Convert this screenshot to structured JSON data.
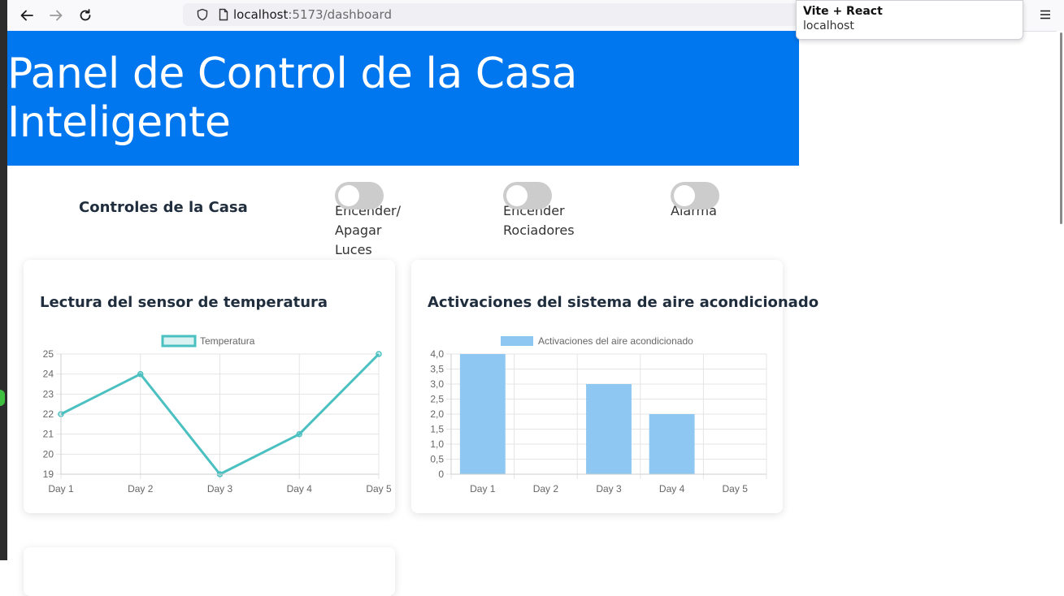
{
  "browser": {
    "url_host": "localhost",
    "url_rest": ":5173/dashboard",
    "tooltip_title": "Vite + React",
    "tooltip_sub": "localhost"
  },
  "header": {
    "title": "Panel de Control de la Casa Inteligente"
  },
  "controls": {
    "title": "Controles de la Casa",
    "toggles": [
      {
        "label": "Encender/ Apagar Luces",
        "on": false
      },
      {
        "label": "Encender Rociadores",
        "on": false
      },
      {
        "label": "Alarma",
        "on": false
      }
    ]
  },
  "cards": {
    "temperature": {
      "title": "Lectura del sensor de temperatura"
    },
    "ac": {
      "title": "Activaciones del sistema de aire acondicionado"
    }
  },
  "chart_data": [
    {
      "type": "line",
      "title": "",
      "categories": [
        "Day 1",
        "Day 2",
        "Day 3",
        "Day 4",
        "Day 5"
      ],
      "series": [
        {
          "name": "Temperatura",
          "values": [
            22,
            24,
            19,
            21,
            25
          ]
        }
      ],
      "ylim": [
        19,
        25
      ],
      "yticks": [
        "19",
        "20",
        "21",
        "22",
        "23",
        "24",
        "25"
      ],
      "legend": "top",
      "grid": true,
      "color": "#4bc0c0"
    },
    {
      "type": "bar",
      "title": "",
      "categories": [
        "Day 1",
        "Day 2",
        "Day 3",
        "Day 4",
        "Day 5"
      ],
      "series": [
        {
          "name": "Activaciones del aire acondicionado",
          "values": [
            4,
            0,
            3,
            2,
            0
          ]
        }
      ],
      "ylim": [
        0,
        4
      ],
      "yticks": [
        "0",
        "0,5",
        "1,0",
        "1,5",
        "2,0",
        "2,5",
        "3,0",
        "3,5",
        "4,0"
      ],
      "legend": "top",
      "grid": true,
      "color": "#8ec8f2"
    }
  ]
}
